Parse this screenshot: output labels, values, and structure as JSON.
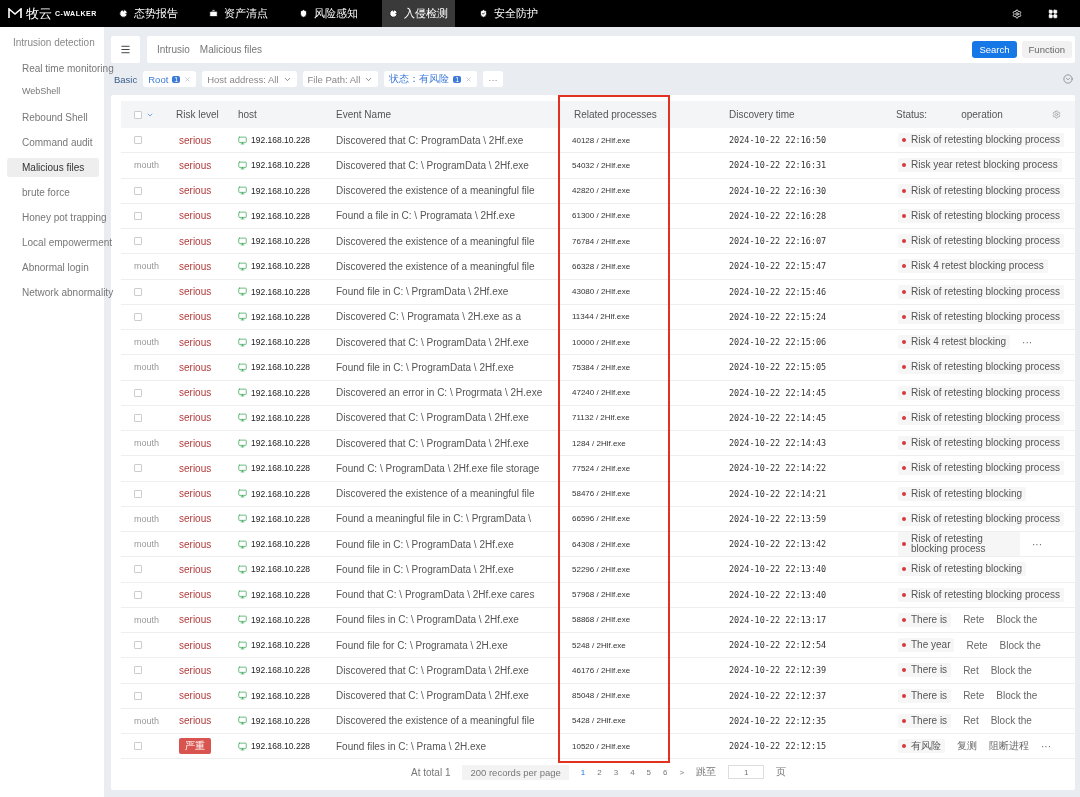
{
  "topbar": {
    "logo_cn": "牧云",
    "logo_en": "C-WALKER",
    "tabs": [
      {
        "label": "态势报告",
        "selected": false
      },
      {
        "label": "资产清点",
        "selected": false
      },
      {
        "label": "风险感知",
        "selected": false
      },
      {
        "label": "入侵检测",
        "selected": true
      },
      {
        "label": "安全防护",
        "selected": false
      }
    ]
  },
  "sidebar": {
    "title": "Intrusion detection",
    "items": [
      {
        "label": "Real time monitoring",
        "selected": false
      },
      {
        "label": "WebShell",
        "selected": false
      },
      {
        "label": "Rebound Shell",
        "selected": false
      },
      {
        "label": "Command audit",
        "selected": false
      },
      {
        "label": "Malicious files",
        "selected": true
      },
      {
        "label": "brute force",
        "selected": false
      },
      {
        "label": "Honey pot trapping",
        "selected": false
      },
      {
        "label": "Local empowerment",
        "selected": false
      },
      {
        "label": "Abnormal login",
        "selected": false
      },
      {
        "label": "Network abnormality",
        "selected": false
      }
    ]
  },
  "search_bar": {
    "breadcrumb": [
      "Intrusio",
      "Malicious files"
    ],
    "buttons": [
      {
        "label": "Search",
        "kind": "primary"
      },
      {
        "label": "Function",
        "kind": "plain"
      }
    ]
  },
  "filters": {
    "basic": "Basic",
    "chips": [
      {
        "label": "Root",
        "kind": "tag",
        "count": "1"
      },
      {
        "label": "Host address: All",
        "kind": "dropdown"
      },
      {
        "label": "File Path: All",
        "kind": "dropdown"
      },
      {
        "label": "状态：有风险",
        "kind": "tag",
        "count": "1"
      },
      {
        "label": "···",
        "kind": "more"
      }
    ]
  },
  "table": {
    "select_all_checked": false,
    "columns": [
      {
        "label": "Risk level",
        "highlighted": false
      },
      {
        "label": "host",
        "highlighted": false
      },
      {
        "label": "Event Name",
        "highlighted": false
      },
      {
        "label": "Related processes",
        "highlighted": true
      },
      {
        "label": "Discovery time",
        "highlighted": false
      },
      {
        "label": "Status:",
        "highlighted": false
      },
      {
        "label": "operation",
        "highlighted": false
      }
    ],
    "rows": [
      {
        "select": {
          "kind": "checkbox",
          "checked": false
        },
        "risk": {
          "kind": "text",
          "label": "serious"
        },
        "host": "192.168.10.228",
        "event": "Discovered that C: ProgramData \\ 2Hf.exe",
        "process": "40128 / 2Hlf.exe",
        "time": "2024-10-22 22:16:50",
        "status": "Risk of retesting blocking process",
        "ops": []
      },
      {
        "select": {
          "kind": "label",
          "label": "mouth"
        },
        "risk": {
          "kind": "text",
          "label": "serious"
        },
        "host": "192.168.10.228",
        "event": "Discovered that C: \\ ProgramData \\ 2Hf.exe",
        "process": "54032 / 2Hlf.exe",
        "time": "2024-10-22 22:16:31",
        "status": "Risk year retest blocking process",
        "ops": []
      },
      {
        "select": {
          "kind": "checkbox",
          "checked": false
        },
        "risk": {
          "kind": "text",
          "label": "serious"
        },
        "host": "192.168.10.228",
        "event": "Discovered the existence of a meaningful file",
        "process": "42820 / 2Hlf.exe",
        "time": "2024-10-22 22:16:30",
        "status": "Risk of retesting blocking process",
        "ops": []
      },
      {
        "select": {
          "kind": "checkbox",
          "checked": false
        },
        "risk": {
          "kind": "text",
          "label": "serious"
        },
        "host": "192.168.10.228",
        "event": "Found a file in C: \\ Programata \\ 2Hf.exe",
        "process": "61300 / 2Hlf.exe",
        "time": "2024-10-22 22:16:28",
        "status": "Risk of retesting blocking process",
        "ops": []
      },
      {
        "select": {
          "kind": "checkbox",
          "checked": false
        },
        "risk": {
          "kind": "text",
          "label": "serious"
        },
        "host": "192.168.10.228",
        "event": "Discovered the existence of a meaningful file",
        "process": "76784 / 2Hlf.exe",
        "time": "2024-10-22 22:16:07",
        "status": "Risk of retesting blocking process",
        "ops": []
      },
      {
        "select": {
          "kind": "label",
          "label": "mouth"
        },
        "risk": {
          "kind": "text",
          "label": "serious"
        },
        "host": "192.168.10.228",
        "event": "Discovered the existence of a meaningful file",
        "process": "66328 / 2Hlf.exe",
        "time": "2024-10-22 22:15:47",
        "status": "Risk 4 retest blocking process",
        "ops": []
      },
      {
        "select": {
          "kind": "checkbox",
          "checked": false
        },
        "risk": {
          "kind": "text",
          "label": "serious"
        },
        "host": "192.168.10.228",
        "event": "Found file in C: \\ PrgramData \\ 2Hf.exe",
        "process": "43080 / 2Hlf.exe",
        "time": "2024-10-22 22:15:46",
        "status": "Risk of retesting blocking process",
        "ops": []
      },
      {
        "select": {
          "kind": "checkbox",
          "checked": false
        },
        "risk": {
          "kind": "text",
          "label": "serious"
        },
        "host": "192.168.10.228",
        "event": "Discovered C: \\ Programata \\ 2H.exe as a",
        "process": "11344 / 2Hlf.exe",
        "time": "2024-10-22 22:15:24",
        "status": "Risk of retesting blocking process",
        "ops": []
      },
      {
        "select": {
          "kind": "label",
          "label": "mouth"
        },
        "risk": {
          "kind": "text",
          "label": "serious"
        },
        "host": "192.168.10.228",
        "event": "Discovered that C: \\ ProgramData \\ 2Hf.exe",
        "process": "10000 / 2Hlf.exe",
        "time": "2024-10-22 22:15:06",
        "status": "Risk 4 retest blocking",
        "ops": [
          "···"
        ]
      },
      {
        "select": {
          "kind": "label",
          "label": "mouth"
        },
        "risk": {
          "kind": "text",
          "label": "serious"
        },
        "host": "192.168.10.228",
        "event": "Found file in C: \\ ProgramData \\ 2Hf.exe",
        "process": "75384 / 2Hlf.exe",
        "time": "2024-10-22 22:15:05",
        "status": "Risk of retesting blocking process",
        "ops": []
      },
      {
        "select": {
          "kind": "checkbox",
          "checked": false
        },
        "risk": {
          "kind": "text",
          "label": "serious"
        },
        "host": "192.168.10.228",
        "event": "Discovered an error in C: \\ Progrmata \\ 2H.exe",
        "process": "47240 / 2Hlf.exe",
        "time": "2024-10-22 22:14:45",
        "status": "Risk of retesting blocking process",
        "ops": []
      },
      {
        "select": {
          "kind": "checkbox",
          "checked": false
        },
        "risk": {
          "kind": "text",
          "label": "serious"
        },
        "host": "192.168.10.228",
        "event": "Discovered that C: \\ ProgramData \\ 2Hf.exe",
        "process": "71132 / 2Hlf.exe",
        "time": "2024-10-22 22:14:45",
        "status": "Risk of retesting blocking process",
        "ops": []
      },
      {
        "select": {
          "kind": "label",
          "label": "mouth"
        },
        "risk": {
          "kind": "text",
          "label": "serious"
        },
        "host": "192.168.10.228",
        "event": "Discovered that C: \\ ProgramData \\ 2Hf.exe",
        "process": "1284 / 2Hlf.exe",
        "time": "2024-10-22 22:14:43",
        "status": "Risk of retesting blocking process",
        "ops": []
      },
      {
        "select": {
          "kind": "checkbox",
          "checked": false
        },
        "risk": {
          "kind": "text",
          "label": "serious"
        },
        "host": "192.168.10.228",
        "event": "Found C: \\ ProgramData \\ 2Hf.exe file storage",
        "process": "77524 / 2Hlf.exe",
        "time": "2024-10-22 22:14:22",
        "status": "Risk of retesting blocking process",
        "ops": []
      },
      {
        "select": {
          "kind": "checkbox",
          "checked": false
        },
        "risk": {
          "kind": "text",
          "label": "serious"
        },
        "host": "192.168.10.228",
        "event": "Discovered the existence of a meaningful file",
        "process": "58476 / 2Hlf.exe",
        "time": "2024-10-22 22:14:21",
        "status": "Risk of retesting blocking",
        "ops": []
      },
      {
        "select": {
          "kind": "label",
          "label": "mouth"
        },
        "risk": {
          "kind": "text",
          "label": "serious"
        },
        "host": "192.168.10.228",
        "event": "Found a meaningful file in C: \\ PrgramData \\",
        "process": "66596 / 2Hlf.exe",
        "time": "2024-10-22 22:13:59",
        "status": "Risk of retesting blocking process",
        "ops": []
      },
      {
        "select": {
          "kind": "label",
          "label": "mouth"
        },
        "risk": {
          "kind": "text",
          "label": "serious"
        },
        "host": "192.168.10.228",
        "event": "Found file in C: \\ ProgramData \\ 2Hf.exe",
        "process": "64308 / 2Hlf.exe",
        "time": "2024-10-22 22:13:42",
        "status": "Risk of retesting blocking process",
        "ops": [
          "···"
        ]
      },
      {
        "select": {
          "kind": "checkbox",
          "checked": false
        },
        "risk": {
          "kind": "text",
          "label": "serious"
        },
        "host": "192.168.10.228",
        "event": "Found file in C: \\ ProgramData \\ 2Hf.exe",
        "process": "52296 / 2Hlf.exe",
        "time": "2024-10-22 22:13:40",
        "status": "Risk of retesting blocking",
        "ops": []
      },
      {
        "select": {
          "kind": "checkbox",
          "checked": false
        },
        "risk": {
          "kind": "text",
          "label": "serious"
        },
        "host": "192.168.10.228",
        "event": "Found that C: \\ ProgramData \\ 2Hf.exe cares",
        "process": "57968 / 2Hlf.exe",
        "time": "2024-10-22 22:13:40",
        "status": "Risk of retesting blocking process",
        "ops": []
      },
      {
        "select": {
          "kind": "label",
          "label": "mouth"
        },
        "risk": {
          "kind": "text",
          "label": "serious"
        },
        "host": "192.168.10.228",
        "event": "Found files in C: \\ ProgramData \\ 2Hf.exe",
        "process": "58868 / 2Hlf.exe",
        "time": "2024-10-22 22:13:17",
        "status": "There is",
        "ops": [
          "Rete",
          "Block the"
        ]
      },
      {
        "select": {
          "kind": "checkbox",
          "checked": false
        },
        "risk": {
          "kind": "text",
          "label": "serious"
        },
        "host": "192.168.10.228",
        "event": "Found file for C: \\ Programata \\ 2H.exe",
        "process": "5248 / 2Hlf.exe",
        "time": "2024-10-22 22:12:54",
        "status": "The year",
        "ops": [
          "Rete",
          "Block the"
        ]
      },
      {
        "select": {
          "kind": "checkbox",
          "checked": false
        },
        "risk": {
          "kind": "text",
          "label": "serious"
        },
        "host": "192.168.10.228",
        "event": "Discovered that C: \\ ProgramData \\ 2Hf.exe",
        "process": "46176 / 2Hlf.exe",
        "time": "2024-10-22 22:12:39",
        "status": "There is",
        "ops": [
          "Ret",
          "Block the"
        ]
      },
      {
        "select": {
          "kind": "checkbox",
          "checked": false
        },
        "risk": {
          "kind": "text",
          "label": "serious"
        },
        "host": "192.168.10.228",
        "event": "Discovered that C: \\ ProgramData \\ 2Hf.exe",
        "process": "85048 / 2Hlf.exe",
        "time": "2024-10-22 22:12:37",
        "status": "There is",
        "ops": [
          "Rete",
          "Block the"
        ]
      },
      {
        "select": {
          "kind": "label",
          "label": "mouth"
        },
        "risk": {
          "kind": "text",
          "label": "serious"
        },
        "host": "192.168.10.228",
        "event": "Discovered the existence of a meaningful file",
        "process": "5428 / 2Hlf.exe",
        "time": "2024-10-22 22:12:35",
        "status": "There is",
        "ops": [
          "Ret",
          "Block the"
        ]
      },
      {
        "select": {
          "kind": "checkbox",
          "checked": false
        },
        "risk": {
          "kind": "badge",
          "label": "严重"
        },
        "host": "192.168.10.228",
        "event": "Found files in C: \\ Prama \\ 2H.exe",
        "process": "10520 / 2Hlf.exe",
        "time": "2024-10-22 22:12:15",
        "status": "有风险",
        "ops": [
          "复测",
          "阻断进程",
          "···"
        ]
      }
    ]
  },
  "pagination": {
    "total": "At total 1",
    "page_size": "200 records per page",
    "pages": [
      {
        "label": "1",
        "selected": true
      },
      {
        "label": "2",
        "selected": false
      },
      {
        "label": "3",
        "selected": false
      },
      {
        "label": "4",
        "selected": false
      },
      {
        "label": "5",
        "selected": false
      },
      {
        "label": "6",
        "selected": false
      }
    ],
    "next": ">",
    "jump_label": "跳至",
    "jump_value": "1",
    "jump_unit": "页"
  }
}
